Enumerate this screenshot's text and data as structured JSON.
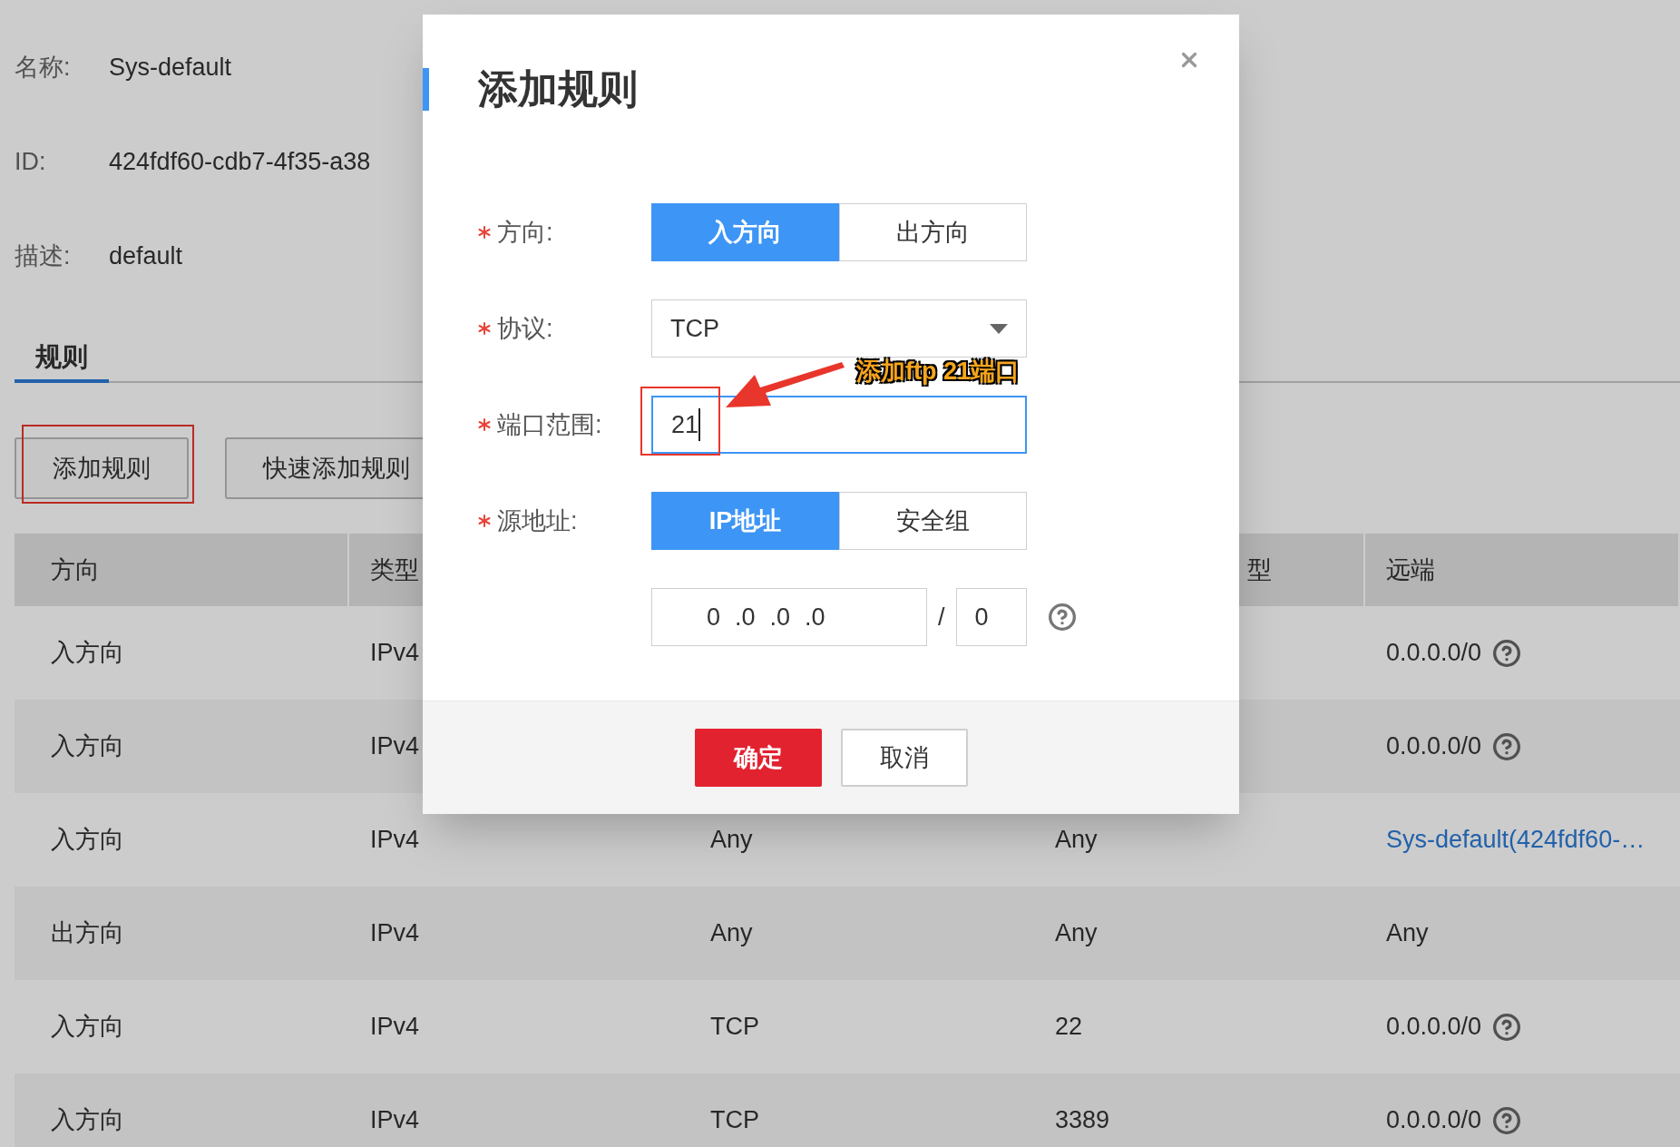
{
  "info": [
    {
      "label": "名称:",
      "value": "Sys-default"
    },
    {
      "label": "ID:",
      "value": "424fdf60-cdb7-4f35-a38"
    },
    {
      "label": "描述:",
      "value": "default"
    }
  ],
  "tabs": [
    {
      "label": "规则",
      "selected": true
    }
  ],
  "actions": [
    {
      "label": "添加规则",
      "highlighted": true
    },
    {
      "label": "快速添加规则",
      "highlighted": false
    }
  ],
  "table": {
    "columns": {
      "direction": "方向",
      "type": "类型",
      "column_4": "型",
      "remote": "远端"
    },
    "rows": [
      {
        "direction": "入方向",
        "type": "IPv4",
        "remote": "0.0.0.0/0",
        "remote_link": false,
        "help": true
      },
      {
        "direction": "入方向",
        "type": "IPv4",
        "remote": "0.0.0.0/0",
        "remote_link": false,
        "help": true
      },
      {
        "direction": "入方向",
        "type": "IPv4",
        "column_3": "Any",
        "column_4": "Any",
        "remote": "Sys-default(424fdf60-…",
        "remote_link": true,
        "help": false
      },
      {
        "direction": "出方向",
        "type": "IPv4",
        "column_3": "Any",
        "column_4": "Any",
        "remote": "Any",
        "remote_link": false,
        "help": false
      },
      {
        "direction": "入方向",
        "type": "IPv4",
        "column_3": "TCP",
        "column_4": "22",
        "remote": "0.0.0.0/0",
        "remote_link": false,
        "help": true
      },
      {
        "direction": "入方向",
        "type": "IPv4",
        "column_3": "TCP",
        "column_4": "3389",
        "remote": "0.0.0.0/0",
        "remote_link": false,
        "help": true
      }
    ]
  },
  "dialog": {
    "title": "添加规则",
    "fields": [
      {
        "kind": "segmented",
        "label": "方向:",
        "required": true,
        "options": [
          {
            "label": "入方向",
            "selected": true
          },
          {
            "label": "出方向",
            "selected": false
          }
        ]
      },
      {
        "kind": "select",
        "label": "协议:",
        "required": true,
        "value": "TCP"
      },
      {
        "kind": "input",
        "label": "端口范围:",
        "required": true,
        "value": "21",
        "focused": true,
        "highlighted": true
      },
      {
        "kind": "segmented",
        "label": "源地址:",
        "required": true,
        "options": [
          {
            "label": "IP地址",
            "selected": true
          },
          {
            "label": "安全组",
            "selected": false
          }
        ]
      },
      {
        "kind": "ip",
        "octets": [
          "0",
          ".0",
          ".0",
          ".0"
        ],
        "separator": "/",
        "mask": "0"
      }
    ],
    "buttons": [
      {
        "label": "确定",
        "kind": "primary"
      },
      {
        "label": "取消",
        "kind": "default"
      }
    ],
    "annotation": {
      "text": "添加ftp 21端口"
    }
  }
}
